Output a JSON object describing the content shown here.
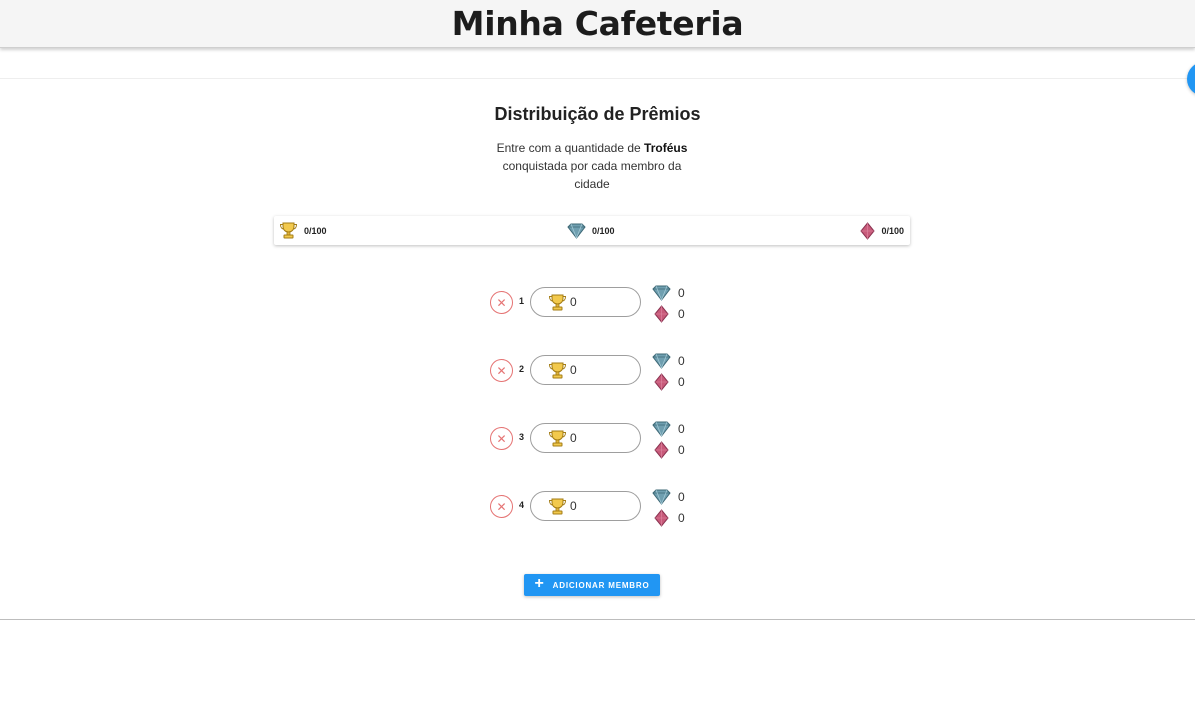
{
  "header": {
    "title": "Minha Cafeteria"
  },
  "section": {
    "title": "Distribuição de Prêmios",
    "subtitle_prefix": "Entre com a quantidade de ",
    "subtitle_bold": "Troféus",
    "subtitle_suffix": " conquistada por cada membro da cidade"
  },
  "totals": {
    "trophies": "0/100",
    "gems": "0/100",
    "diamonds": "0/100"
  },
  "members": [
    {
      "number": "1",
      "trophies": "0",
      "gems": "0",
      "diamonds": "0"
    },
    {
      "number": "2",
      "trophies": "0",
      "gems": "0",
      "diamonds": "0"
    },
    {
      "number": "3",
      "trophies": "0",
      "gems": "0",
      "diamonds": "0"
    },
    {
      "number": "4",
      "trophies": "0",
      "gems": "0",
      "diamonds": "0"
    }
  ],
  "add_member_label": "ADICIONAR MEMBRO",
  "icons": {
    "trophy": "trophy-icon",
    "gem": "gem-icon",
    "diamond": "diamond-icon",
    "remove": "close-icon",
    "add": "plus-icon"
  },
  "colors": {
    "primary": "#2196f3",
    "remove": "#e57373",
    "trophy": "#f2c94c",
    "gem": "#6f9fb0",
    "diamond": "#c85a7a"
  }
}
